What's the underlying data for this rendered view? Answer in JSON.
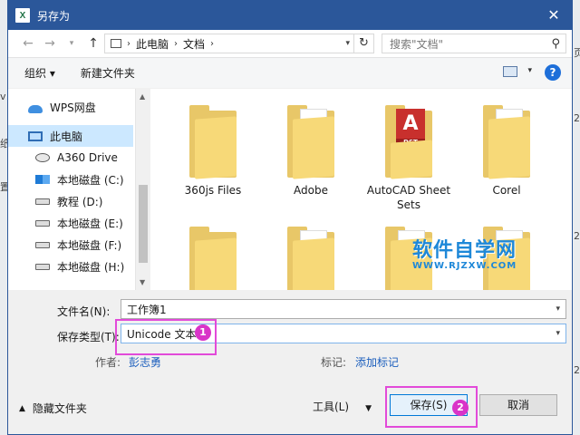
{
  "window": {
    "title": "另存为",
    "app_icon": "X"
  },
  "nav": {
    "crumbs": [
      "此电脑",
      "文档"
    ],
    "search_placeholder": "搜索\"文档\""
  },
  "toolbar": {
    "organize": "组织",
    "new_folder": "新建文件夹",
    "help": "?"
  },
  "sidebar": {
    "items": [
      {
        "label": "WPS网盘",
        "icon": "cloud-icon"
      },
      {
        "label": "此电脑",
        "icon": "computer-icon",
        "selected": true
      },
      {
        "label": "A360 Drive",
        "icon": "network-drive-icon"
      },
      {
        "label": "本地磁盘 (C:)",
        "icon": "windows-drive-icon"
      },
      {
        "label": "教程 (D:)",
        "icon": "drive-icon"
      },
      {
        "label": "本地磁盘 (E:)",
        "icon": "drive-icon"
      },
      {
        "label": "本地磁盘 (F:)",
        "icon": "drive-icon"
      },
      {
        "label": "本地磁盘 (H:)",
        "icon": "drive-icon"
      }
    ]
  },
  "files": [
    {
      "name": "360js Files",
      "icon": "folder-icon"
    },
    {
      "name": "Adobe",
      "icon": "folder-document-icon"
    },
    {
      "name": "AutoCAD Sheet Sets",
      "icon": "autocad-folder-icon",
      "badge": "A",
      "badge_sub": "DST"
    },
    {
      "name": "Corel",
      "icon": "folder-document-icon"
    },
    {
      "name": "",
      "icon": "folder-icon"
    },
    {
      "name": "",
      "icon": "folder-document-icon"
    },
    {
      "name": "",
      "icon": "folder-document-icon"
    },
    {
      "name": "",
      "icon": "folder-document-icon"
    }
  ],
  "watermark": {
    "title": "软件自学网",
    "url": "WWW.RJZXW.COM"
  },
  "form": {
    "filename_label": "文件名(N):",
    "filename_value": "工作簿1",
    "filetype_label": "保存类型(T):",
    "filetype_value": "Unicode 文本",
    "author_label": "作者:",
    "author_value": "彭志勇",
    "tags_label": "标记:",
    "tags_value": "添加标记"
  },
  "annotations": {
    "badge1": "1",
    "badge2": "2",
    "color": "#e24ad9"
  },
  "footer": {
    "hide_folders": "隐藏文件夹",
    "tools": "工具(L)",
    "save": "保存(S)",
    "cancel": "取消"
  },
  "backdrop": {
    "left_chars": [
      "i",
      "v",
      "i",
      "纸",
      "置"
    ],
    "right_chars": [
      "页",
      "2",
      "2",
      "2"
    ]
  }
}
